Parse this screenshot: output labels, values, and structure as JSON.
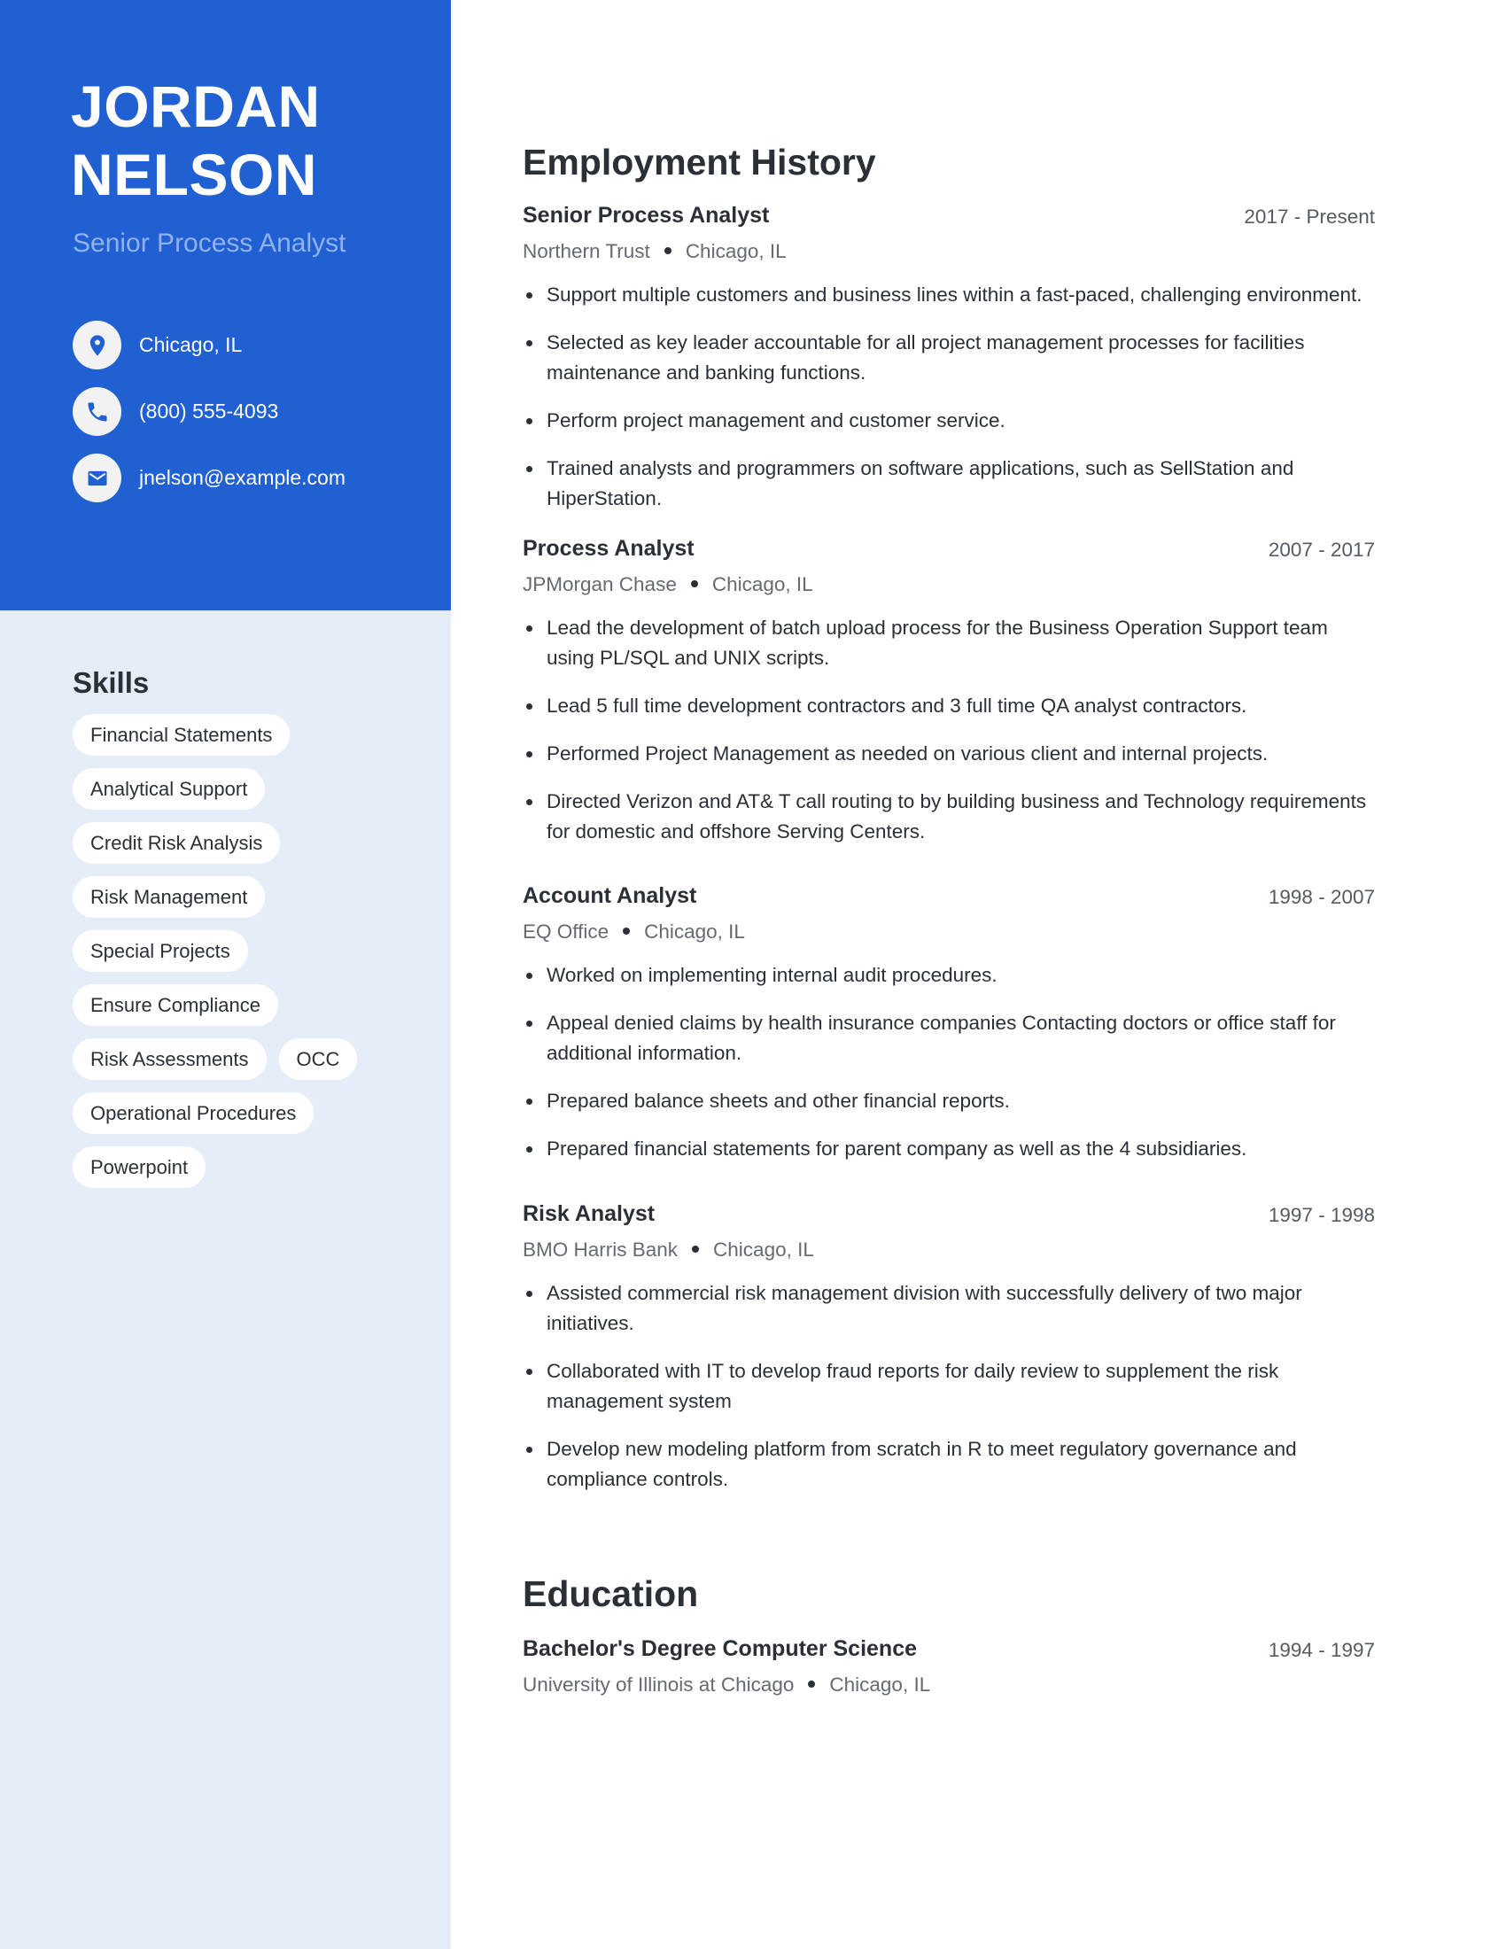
{
  "colors": {
    "sidebar_accent": "#2160D3",
    "sidebar_light": "#E5EDF9",
    "headline": "#8FB2EE",
    "text_dark": "#2B2F36",
    "text_muted": "#666A70"
  },
  "profile": {
    "first_name": "JORDAN",
    "last_name": "NELSON",
    "headline": "Senior Process Analyst"
  },
  "contacts": [
    {
      "icon": "map-pin-icon",
      "text": "Chicago, IL"
    },
    {
      "icon": "phone-icon",
      "text": "(800) 555-4093"
    },
    {
      "icon": "mail-icon",
      "text": "jnelson@example.com"
    }
  ],
  "skills": {
    "title": "Skills",
    "items": [
      "Financial Statements",
      "Analytical Support",
      "Credit Risk Analysis",
      "Risk Management",
      "Special Projects",
      "Ensure Compliance",
      "Risk Assessments",
      "OCC",
      "Operational Procedures",
      "Powerpoint"
    ]
  },
  "employment": {
    "title": "Employment History",
    "jobs": [
      {
        "title": "Senior Process Analyst",
        "date": "2017 - Present",
        "company": "Northern Trust",
        "location": "Chicago, IL",
        "bullets": [
          "Support multiple customers and business lines within a fast-paced, challenging environment.",
          "Selected as key leader accountable for all project management processes for facilities maintenance and banking functions.",
          "Perform project management and customer service.",
          "Trained analysts and programmers on software applications, such as SellStation and HiperStation."
        ]
      },
      {
        "title": "Process Analyst",
        "date": "2007 - 2017",
        "company": "JPMorgan Chase",
        "location": "Chicago, IL",
        "bullets": [
          "Lead the development of batch upload process for the Business Operation Support team using PL/SQL and UNIX scripts.",
          "Lead 5 full time development contractors and 3 full time QA analyst contractors.",
          "Performed Project Management as needed on various client and internal projects.",
          "Directed Verizon and AT& T call routing to by building business and Technology requirements for domestic and offshore Serving Centers."
        ]
      },
      {
        "title": "Account Analyst",
        "date": "1998 - 2007",
        "company": "EQ Office",
        "location": "Chicago, IL",
        "bullets": [
          "Worked on implementing internal audit procedures.",
          "Appeal denied claims by health insurance companies Contacting doctors or office staff for additional information.",
          "Prepared balance sheets and other financial reports.",
          "Prepared financial statements for parent company as well as the 4 subsidiaries."
        ]
      },
      {
        "title": "Risk Analyst",
        "date": "1997 - 1998",
        "company": "BMO Harris Bank",
        "location": "Chicago, IL",
        "bullets": [
          "Assisted commercial risk management division with successfully delivery of two major initiatives.",
          "Collaborated with IT to develop fraud reports for daily review to supplement the risk management system",
          "Develop new modeling platform from scratch in R to meet regulatory governance and compliance controls."
        ]
      }
    ]
  },
  "education": {
    "title": "Education",
    "entries": [
      {
        "title": "Bachelor's Degree Computer Science",
        "date": "1994 - 1997",
        "school": "University of Illinois at Chicago",
        "location": "Chicago, IL"
      }
    ]
  }
}
